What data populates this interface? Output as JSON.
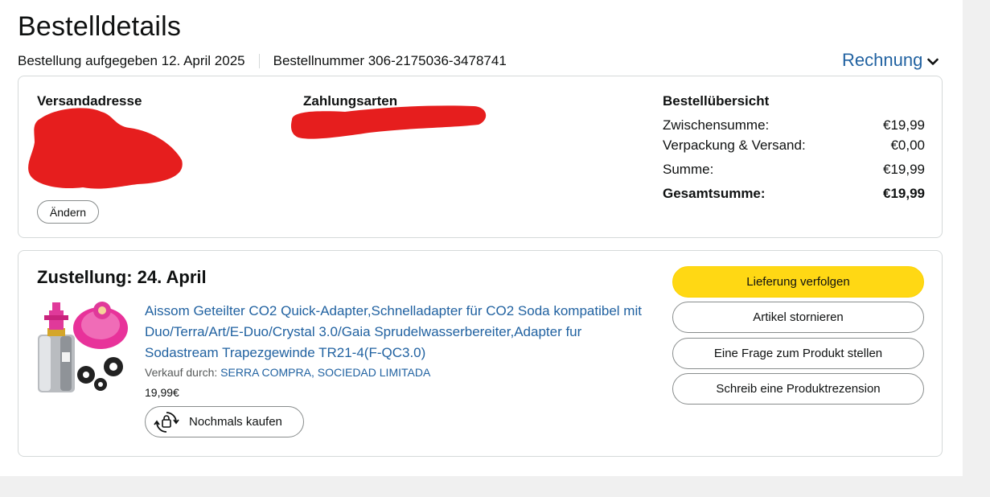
{
  "header": {
    "title": "Bestelldetails",
    "order_date": "Bestellung aufgegeben 12. April 2025",
    "order_number": "Bestellnummer 306-2175036-3478741",
    "invoice_label": "Rechnung"
  },
  "summary_card": {
    "shipping_label": "Versandadresse",
    "payment_label": "Zahlungsarten",
    "change_button": "Ändern",
    "overview_label": "Bestellübersicht",
    "rows": [
      {
        "label": "Zwischensumme:",
        "value": "€19,99"
      },
      {
        "label": "Verpackung & Versand:",
        "value": "€0,00"
      },
      {
        "label": "Summe:",
        "value": "€19,99"
      },
      {
        "label": "Gesamtsumme:",
        "value": "€19,99"
      }
    ]
  },
  "delivery": {
    "title": "Zustellung: 24. April",
    "product_title": "Aissom Geteilter CO2 Quick-Adapter,Schnelladapter für CO2 Soda kompatibel mit Duo/Terra/Art/E-Duo/Crystal 3.0/Gaia Sprudelwasserbereiter,Adapter fur Sodastream Trapezgewinde TR21-4(F-QC3.0)",
    "seller_label": "Verkauf durch:",
    "seller_name": "SERRA COMPRA, SOCIEDAD LIMITADA",
    "price": "19,99€",
    "buy_again": "Nochmals kaufen",
    "actions": {
      "track": "Lieferung verfolgen",
      "cancel": "Artikel stornieren",
      "question": "Eine Frage zum Produkt stellen",
      "review": "Schreib eine Produktrezension"
    }
  },
  "colors": {
    "link": "#2162a1",
    "primary_button": "#ffd814",
    "redaction": "#e61e1e"
  }
}
